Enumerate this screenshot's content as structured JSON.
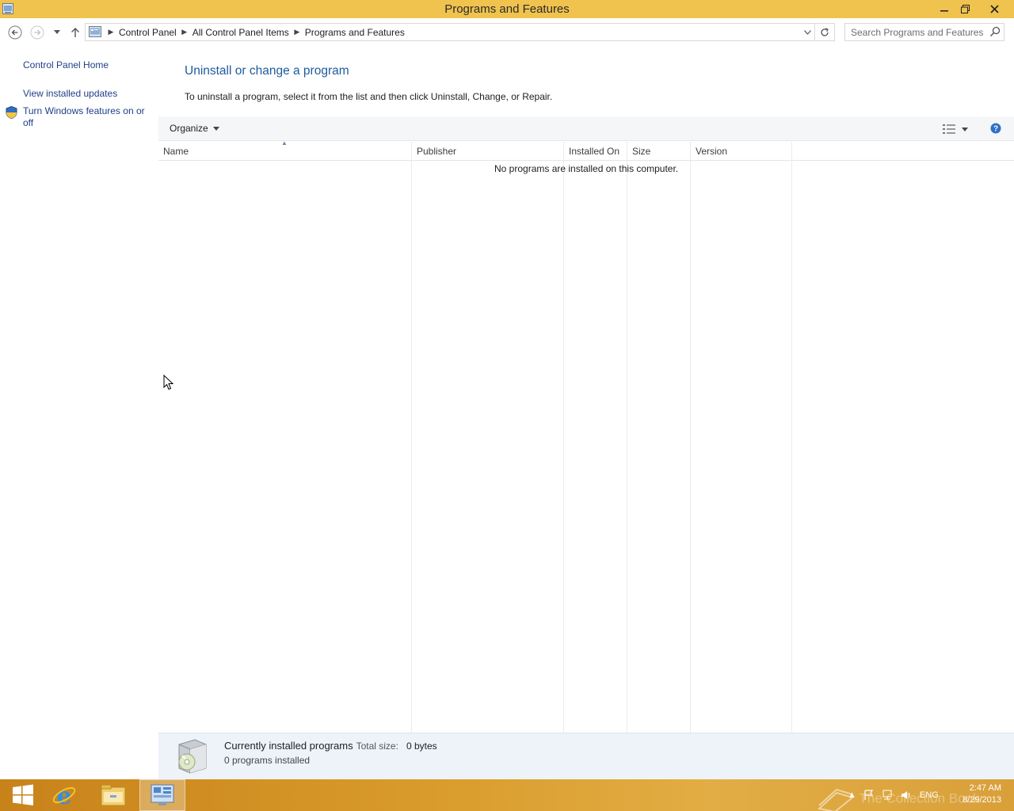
{
  "window": {
    "title": "Programs and Features",
    "minimize_icon": "minimize-icon",
    "maximize_icon": "restore-icon",
    "close_icon": "close-icon"
  },
  "address_bar": {
    "breadcrumbs": [
      "Control Panel",
      "All Control Panel Items",
      "Programs and Features"
    ],
    "search_placeholder": "Search Programs and Features"
  },
  "left_pane": {
    "home_link": "Control Panel Home",
    "updates_link": "View installed updates",
    "features_link": "Turn Windows features on or off"
  },
  "main": {
    "heading": "Uninstall or change a program",
    "instructions": "To uninstall a program, select it from the list and then click Uninstall, Change, or Repair.",
    "organize_label": "Organize",
    "columns": [
      "Name",
      "Publisher",
      "Installed On",
      "Size",
      "Version"
    ],
    "empty_message": "No programs are installed on this computer."
  },
  "details_pane": {
    "title": "Currently installed programs",
    "total_size_label": "Total size:",
    "total_size_value": "0 bytes",
    "count_text": "0 programs installed"
  },
  "taskbar": {
    "items": [
      "start-icon",
      "internet-explorer-icon",
      "file-explorer-icon",
      "control-panel-icon"
    ],
    "language": "ENG",
    "time": "2:47 AM",
    "date": "8/29/2013",
    "watermark": "The Collection Book"
  },
  "colors": {
    "title_bar": "#f0c34e",
    "link": "#1f3f87",
    "heading": "#1e5a9e",
    "taskbar": "#d89a2a"
  }
}
